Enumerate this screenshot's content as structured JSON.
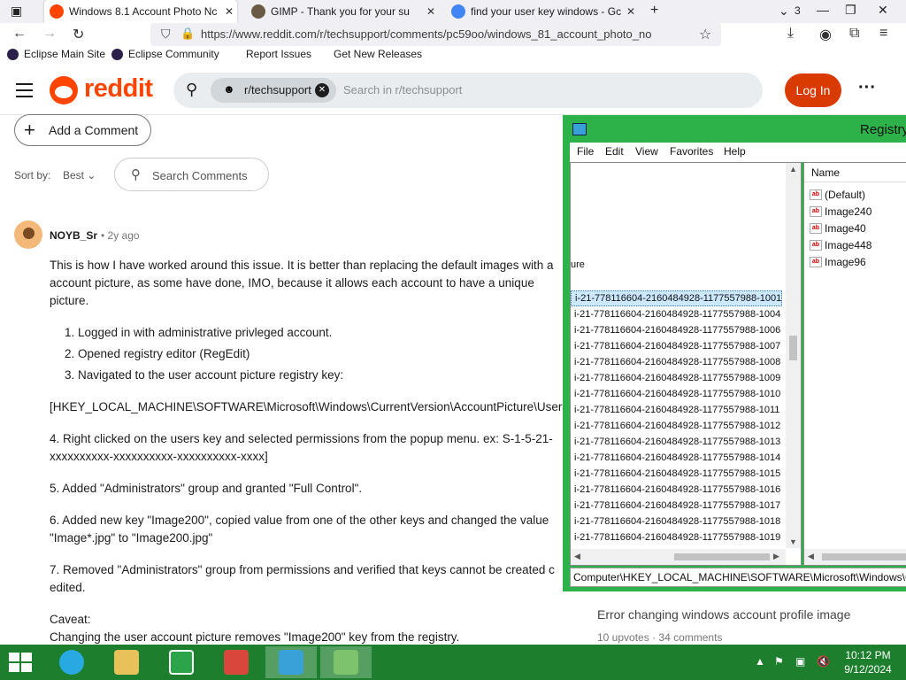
{
  "browser": {
    "tabs": [
      {
        "label": "Windows 8.1 Account Photo Nc",
        "icon": "reddit-icon",
        "active": true
      },
      {
        "label": "GIMP - Thank you for your su",
        "icon": "gimp-icon",
        "active": false
      },
      {
        "label": "find your user key windows - Gc",
        "icon": "google-icon",
        "active": false
      }
    ],
    "tab_count": "3",
    "url": "https://www.reddit.com/r/techsupport/comments/pc59oo/windows_81_account_photo_no",
    "bookmarks": [
      "Eclipse Main Site",
      "Eclipse Community",
      "Report Issues",
      "Get New Releases"
    ]
  },
  "reddit": {
    "logo_text": "reddit",
    "subreddit_chip": "r/techsupport",
    "search_placeholder": "Search in r/techsupport",
    "login_label": "Log In",
    "add_comment": "Add a Comment",
    "sort_by": "Sort by:",
    "sort_value": "Best",
    "search_comments": "Search Comments",
    "comment": {
      "author": "NOYB_Sr",
      "age": "• 2y ago",
      "intro": "This is how I have worked around this issue. It is better than replacing the default images with a",
      "intro2": "account picture, as some have done, IMO, because it allows each account to have a unique",
      "intro3": "picture.",
      "steps": [
        "Logged in with administrative privleged account.",
        "Opened registry editor (RegEdit)",
        "Navigated to the user account picture registry key:"
      ],
      "key_path": "[HKEY_LOCAL_MACHINE\\SOFTWARE\\Microsoft\\Windows\\CurrentVersion\\AccountPicture\\Users",
      "p4a": "4. Right clicked on the users key and selected permissions from the popup menu. ex: S-1-5-21-",
      "p4b": "xxxxxxxxxx-xxxxxxxxxx-xxxxxxxxxx-xxxx]",
      "p5": "5. Added \"Administrators\" group and granted \"Full Control\".",
      "p6a": "6. Added new key \"Image200\", copied value from one of the other keys and changed the value",
      "p6b": "\"Image*.jpg\" to \"Image200.jpg\"",
      "p7a": "7. Removed \"Administrators\" group from permissions and verified that keys cannot be created c",
      "p7b": "edited.",
      "caveat_title": "Caveat:",
      "caveat": "Changing the user account picture removes \"Image200\" key from the registry."
    },
    "related": {
      "title": "Error changing windows account profile image",
      "upvotes": "10 upvotes",
      "separator": "·",
      "comments": "34 comments"
    }
  },
  "regedit": {
    "title": "Registry",
    "menu": [
      "File",
      "Edit",
      "View",
      "Favorites",
      "Help"
    ],
    "tree_caption": "ure",
    "keys": [
      "i-21-778116604-2160484928-1177557988-1001",
      "i-21-778116604-2160484928-1177557988-1004",
      "i-21-778116604-2160484928-1177557988-1006",
      "i-21-778116604-2160484928-1177557988-1007",
      "i-21-778116604-2160484928-1177557988-1008",
      "i-21-778116604-2160484928-1177557988-1009",
      "i-21-778116604-2160484928-1177557988-1010",
      "i-21-778116604-2160484928-1177557988-1011",
      "i-21-778116604-2160484928-1177557988-1012",
      "i-21-778116604-2160484928-1177557988-1013",
      "i-21-778116604-2160484928-1177557988-1014",
      "i-21-778116604-2160484928-1177557988-1015",
      "i-21-778116604-2160484928-1177557988-1016",
      "i-21-778116604-2160484928-1177557988-1017",
      "i-21-778116604-2160484928-1177557988-1018",
      "i-21-778116604-2160484928-1177557988-1019"
    ],
    "selected_key_index": 0,
    "values_header": "Name",
    "values": [
      "(Default)",
      "Image240",
      "Image40",
      "Image448",
      "Image96"
    ],
    "value_type_icon": "ab",
    "status_path": "Computer\\HKEY_LOCAL_MACHINE\\SOFTWARE\\Microsoft\\Windows\\C"
  },
  "taskbar": {
    "time": "10:12 PM",
    "date": "9/12/2024"
  },
  "colors": {
    "reddit_orange": "#ff4500",
    "login_red": "#d93a00",
    "regedit_frame": "#2db24a",
    "taskbar": "#1d7f2e",
    "selection": "#cce8ff"
  }
}
